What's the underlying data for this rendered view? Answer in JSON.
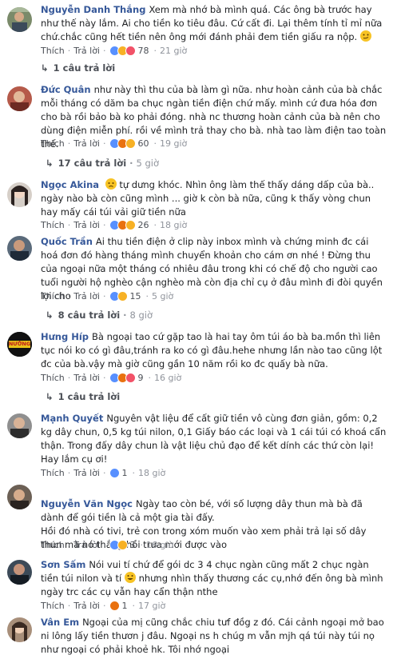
{
  "comments": [
    {
      "author": "Nguyễn Danh Thắng",
      "text": "Xem mà nhớ bà mình quá. Các ông bà trước hay như thế này lắm. Ai cho tiền ko tiêu đâu. Cứ cất đi. Lại thêm tính tỉ mỉ nữa chứ.chắc cũng hết tiền nên ông mới đánh phải đem tiền giấu ra nộp.",
      "like": "Thích",
      "reply": "Trả lời",
      "reactions": "78",
      "time": "21 giờ",
      "replies": "1 câu trả lời"
    },
    {
      "author": "Đức Quân",
      "text": "như này thì thu của bà làm gì nữa. như hoàn cảnh của bà chắc mỗi tháng có dăm ba chục ngàn tiền điện chứ mấy. mình cứ đưa hóa đơn cho bà rồi bảo bà ko phải đóng. nhà nc thương hoàn cảnh của bà nên cho dùng điện miễn phí. rồi về mình trả thay cho bà. nhà tao làm điện tao toàn thế.",
      "like": "Thích",
      "reply": "Trả lời",
      "reactions": "60",
      "time": "19 giờ",
      "replies": "17 câu trả lời",
      "replies_time": "5 giờ"
    },
    {
      "author": "Ngọc Akina",
      "text": "tự dưng khóc. Nhìn ông làm thế thấy dáng dấp của bà.. ngày nào bà còn cũng mình ... giờ k còn bà nữa, cũng k thấy vòng chun hay mấy cái túi vải giữ tiền nữa",
      "like": "Thích",
      "reply": "Trả lời",
      "reactions": "26",
      "time": "18 giờ"
    },
    {
      "author": "Quốc Trần",
      "text": "Ai thu tiền điện ở clip này inbox mình và chứng minh đc cái hoá đơn đó hàng tháng mình chuyển khoản cho cám ơn nhé ! Đừng thu của ngoại nữa một tháng có nhiêu đâu trong khi có chế độ cho người cao tuổi người hộ nghèo cận nghèo mà còn địa chỉ cụ ở đâu mình đi đòi quyền lợi cho",
      "like": "Thích",
      "reply": "Trả lời",
      "reactions": "15",
      "time": "5 giờ",
      "replies": "8 câu trả lời",
      "replies_time": "8 giờ"
    },
    {
      "author": "Hưng Híp",
      "text": "Bà ngoại tao cứ gặp tao là hai tay ôm túi áo bà ba.mồn thì liên tục nói ko có gì đâu,tránh ra ko có gì đâu.hehe nhưng lần nào tao cũng lột đc của bà.vậy mà giờ cũng gần 10 năm rồi ko đc quấy bà nữa.",
      "avatar_text": "NƯỚNG",
      "like": "Thích",
      "reply": "Trả lời",
      "reactions": "9",
      "time": "16 giờ",
      "replies": "1 câu trả lời"
    },
    {
      "author": "Mạnh Quyết",
      "text": "Nguyên vật liệu để cất giữ tiền vô cùng đơn giản, gồm: 0,2 kg dây chun, 0,5 kg túi nilon, 0,1 Giấy báo các loại và 1 cái túi có khoá cẩn thận. Trong đấy dây chun là vật liệu chủ đạo để kết dính các thứ còn lại! Hay lắm cụ ơi!",
      "like": "Thích",
      "reply": "Trả lời",
      "reactions": "1",
      "time": "18 giờ"
    },
    {
      "author": "Nguyễn Văn Ngọc",
      "text": "Ngày tao còn bé, với số lượng dây thun mà bà đã dành để gói tiền là cả một gia tài đấy.\nHồi đó nhà có tivi, trẻ con trong xóm muốn vào xem phải trả lại số dây thun mà nó thắng hồi trưa mới được vào",
      "like": "Thích",
      "reply": "Trả lời",
      "reactions": "3",
      "time": "16 giờ"
    },
    {
      "author": "Sơn Sấm",
      "text_a": "Nói vui tí chứ để gói dc 3 4 chục ngàn cũng mất 2 chục ngàn tiền túi nilon và tí",
      "text_b": "nhưng nhìn thấy thương các cụ,nhớ đến ông bà mình ngày trc các cụ vẫn hay cẩn thận nthe",
      "like": "Thích",
      "reply": "Trả lời",
      "reactions": "1",
      "time": "17 giờ"
    },
    {
      "author": "Vân Em",
      "text": "Ngoại của mị cũng chắc chiu tưf đồg z đó. Cái cảnh ngoại mở bao ni lông lấy tiền thươn j đâu. Ngoại ns h chúg m vẫn mjh qá túi này túi nọ như ngoại có phải khoẻ hk. Tôi nhớ ngoại"
    }
  ]
}
